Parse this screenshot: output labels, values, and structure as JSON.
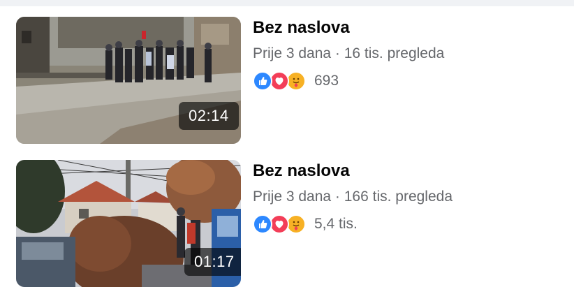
{
  "videos": [
    {
      "title": "Bez naslova",
      "meta": "Prije 3 dana · 16 tis. pregleda",
      "duration": "02:14",
      "reaction_count": "693",
      "reactions": [
        "like-icon",
        "love-icon",
        "care-icon"
      ]
    },
    {
      "title": "Bez naslova",
      "meta": "Prije 3 dana · 166 tis. pregleda",
      "duration": "01:17",
      "reaction_count": "5,4 tis.",
      "reactions": [
        "like-icon",
        "love-icon",
        "care-icon"
      ]
    }
  ],
  "colors": {
    "like": "#2d88ff",
    "love": "#f33e58",
    "care": "#f7b125",
    "secondary_text": "#65676b",
    "primary_text": "#050505"
  }
}
